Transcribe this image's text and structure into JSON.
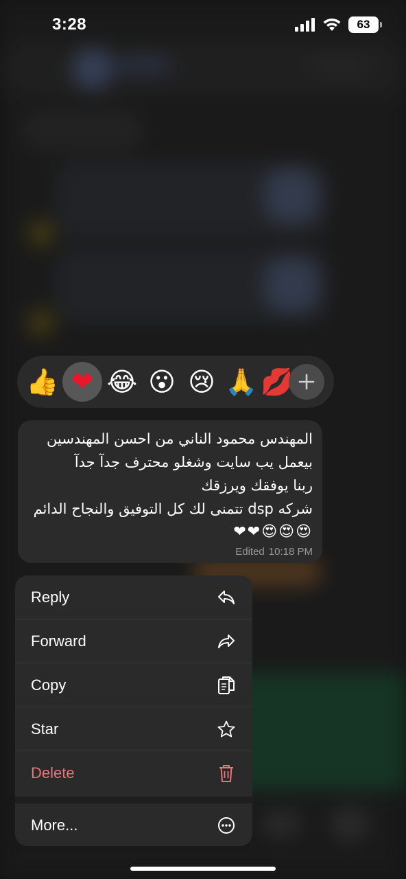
{
  "status_bar": {
    "time": "3:28",
    "battery": "63"
  },
  "reactions": [
    {
      "name": "thumbs-up",
      "glyph": "👍"
    },
    {
      "name": "red-heart",
      "glyph": "❤"
    },
    {
      "name": "tears-of-joy",
      "glyph": "😂"
    },
    {
      "name": "surprised",
      "glyph": "😮"
    },
    {
      "name": "crying",
      "glyph": "😢"
    },
    {
      "name": "folded-hands",
      "glyph": "🙏"
    },
    {
      "name": "kiss-mark",
      "glyph": "💋"
    }
  ],
  "selected_reaction": "red-heart",
  "message": {
    "lines": [
      "المهندس محمود الناني من احسن المهندسين",
      "بيعمل يب سايت وشغلو محترف جدآ جدآ",
      "ربنا يوفقك ويرزقك",
      "شركه dsp تتمنى لك كل التوفيق والنجاح الدائم"
    ],
    "emojis": "😍😍😍❤❤",
    "edited_label": "Edited",
    "time": "10:18 PM"
  },
  "menu": {
    "items": [
      {
        "label": "Reply",
        "icon": "reply-icon"
      },
      {
        "label": "Forward",
        "icon": "forward-icon"
      },
      {
        "label": "Copy",
        "icon": "copy-icon"
      },
      {
        "label": "Star",
        "icon": "star-icon"
      },
      {
        "label": "Delete",
        "icon": "trash-icon"
      },
      {
        "label": "More...",
        "icon": "more-icon"
      }
    ]
  },
  "colors": {
    "background": "#1c1c1c",
    "menu": "#2a2a2a",
    "bubble": "#2b2b2b",
    "danger": "#e8757c",
    "heart": "#e8172b"
  }
}
